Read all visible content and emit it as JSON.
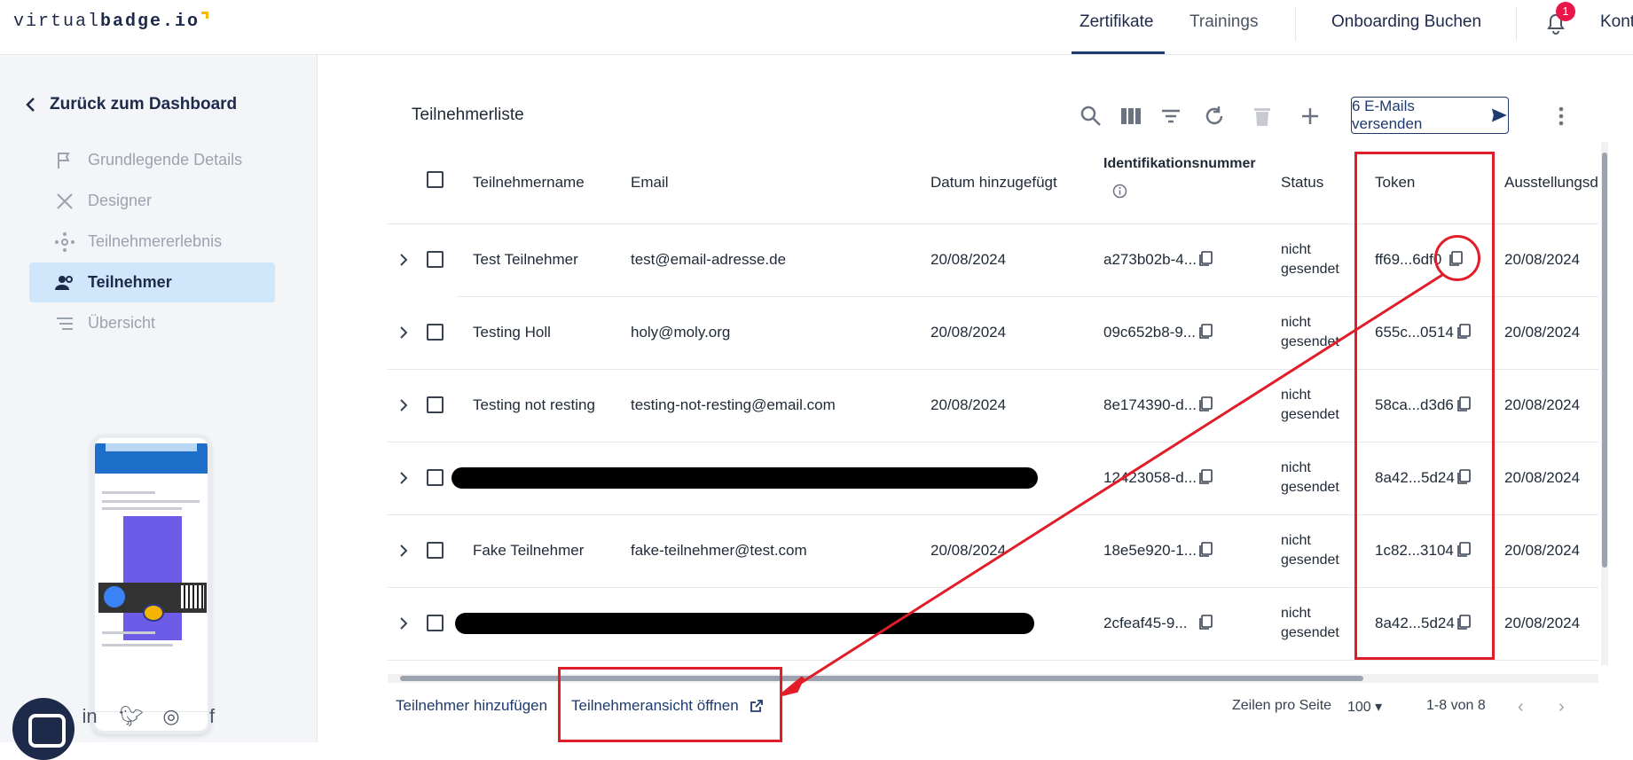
{
  "header": {
    "logo_light": "virtual",
    "logo_bold": "badge.io",
    "nav": [
      "Zertifikate",
      "Trainings"
    ],
    "cta": "Onboarding Buchen",
    "notifications": "1",
    "account": "Kont"
  },
  "sidebar": {
    "back": "Zurück zum Dashboard",
    "items": [
      {
        "label": "Grundlegende Details",
        "icon": "flag-icon"
      },
      {
        "label": "Designer",
        "icon": "tools-icon"
      },
      {
        "label": "Teilnehmererlebnis",
        "icon": "network-icon"
      },
      {
        "label": "Teilnehmer",
        "icon": "people-icon"
      },
      {
        "label": "Übersicht",
        "icon": "list-icon"
      }
    ]
  },
  "toolbar": {
    "title": "Teilnehmerliste",
    "send_label": "6 E-Mails versenden"
  },
  "table": {
    "headers": {
      "name": "Teilnehmername",
      "email": "Email",
      "date": "Datum hinzugefügt",
      "id": "Identifikationsnummer",
      "status": "Status",
      "token": "Token",
      "issued": "Ausstellungsd"
    },
    "rows": [
      {
        "name": "Test Teilnehmer",
        "email": "test@email-adresse.de",
        "date": "20/08/2024",
        "id": "a273b02b-4...",
        "status": "nicht gesendet",
        "token": "ff69...6df0",
        "issued": "20/08/2024",
        "redacted": false
      },
      {
        "name": "Testing Holl",
        "email": "holy@moly.org",
        "date": "20/08/2024",
        "id": "09c652b8-9...",
        "status": "nicht gesendet",
        "token": "655c...0514",
        "issued": "20/08/2024",
        "redacted": false
      },
      {
        "name": "Testing not resting",
        "email": "testing-not-resting@email.com",
        "date": "20/08/2024",
        "id": "8e174390-d...",
        "status": "nicht gesendet",
        "token": "58ca...d3d6",
        "issued": "20/08/2024",
        "redacted": false
      },
      {
        "name": "",
        "email": "",
        "date": "",
        "id": "12423058-d...",
        "status": "nicht gesendet",
        "token": "8a42...5d24",
        "issued": "20/08/2024",
        "redacted": true
      },
      {
        "name": "Fake Teilnehmer",
        "email": "fake-teilnehmer@test.com",
        "date": "20/08/2024",
        "id": "18e5e920-1...",
        "status": "nicht gesendet",
        "token": "1c82...3104",
        "issued": "20/08/2024",
        "redacted": false
      },
      {
        "name": "",
        "email": "",
        "date": "",
        "id": "2cfeaf45-9...",
        "status": "nicht gesendet",
        "token": "8a42...5d24",
        "issued": "20/08/2024",
        "redacted": true
      }
    ]
  },
  "footer": {
    "add": "Teilnehmer hinzufügen",
    "open_view": "Teilnehmeransicht öffnen",
    "rows_per_page_label": "Zeilen pro Seite",
    "rows_per_page": "100",
    "range": "1-8 von 8"
  },
  "colors": {
    "accent": "#1e3a6e",
    "annotation": "#e11d2a",
    "active_bg": "#cfe6fb",
    "badge": "#e8174a"
  }
}
